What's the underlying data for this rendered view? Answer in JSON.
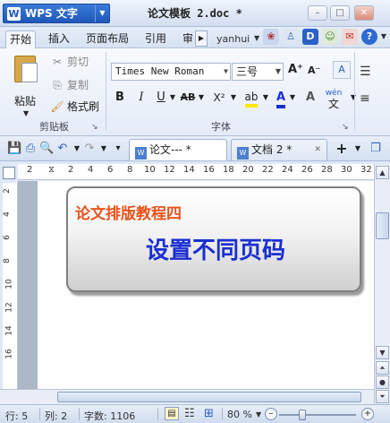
{
  "app": {
    "brand_logo": "W",
    "brand_label": "WPS 文字",
    "document_title": "论文模板 2.doc *"
  },
  "window_controls": {
    "minimize": "–",
    "maximize": "□",
    "close": "✕"
  },
  "ribbon_tabs": [
    "开始",
    "插入",
    "页面布局",
    "引用",
    "审"
  ],
  "user": {
    "name": "yanhui"
  },
  "toolbar_icons": [
    "skin-icon",
    "shirt-icon",
    "d-icon",
    "community-icon",
    "gift-icon",
    "help-icon"
  ],
  "clipboard": {
    "group_label": "剪贴板",
    "paste_label": "粘贴",
    "cut_label": "剪切",
    "copy_label": "复制",
    "format_painter_label": "格式刷"
  },
  "font": {
    "group_label": "字体",
    "font_name": "Times New Roman",
    "font_size": "三号",
    "bold": "B",
    "italic": "I",
    "underline": "U",
    "strikethrough": "AB",
    "superscript": "X²",
    "grow": "A⁺",
    "shrink": "A⁻",
    "pinyin": "wén"
  },
  "document_tabs": [
    {
      "label": "论文--- *",
      "active": true
    },
    {
      "label": "文档 2 *",
      "active": false
    }
  ],
  "ruler": {
    "h_ticks": [
      "2",
      "2",
      "4",
      "6",
      "8",
      "10",
      "12",
      "14",
      "16",
      "18",
      "20",
      "22",
      "24",
      "26",
      "28",
      "30",
      "32"
    ],
    "v_ticks": [
      "2",
      "4",
      "6",
      "8",
      "10",
      "12",
      "14",
      "16"
    ]
  },
  "content": {
    "heading": "论文排版教程四",
    "title": "设置不同页码"
  },
  "status": {
    "line": "行: 5",
    "column": "列: 2",
    "word_count": "字数: 1106",
    "zoom": "80 %",
    "zoom_fraction": 0.3
  },
  "colors": {
    "heading": "#e8531c",
    "title": "#1a2fd0",
    "brand": "#1f57b8"
  }
}
